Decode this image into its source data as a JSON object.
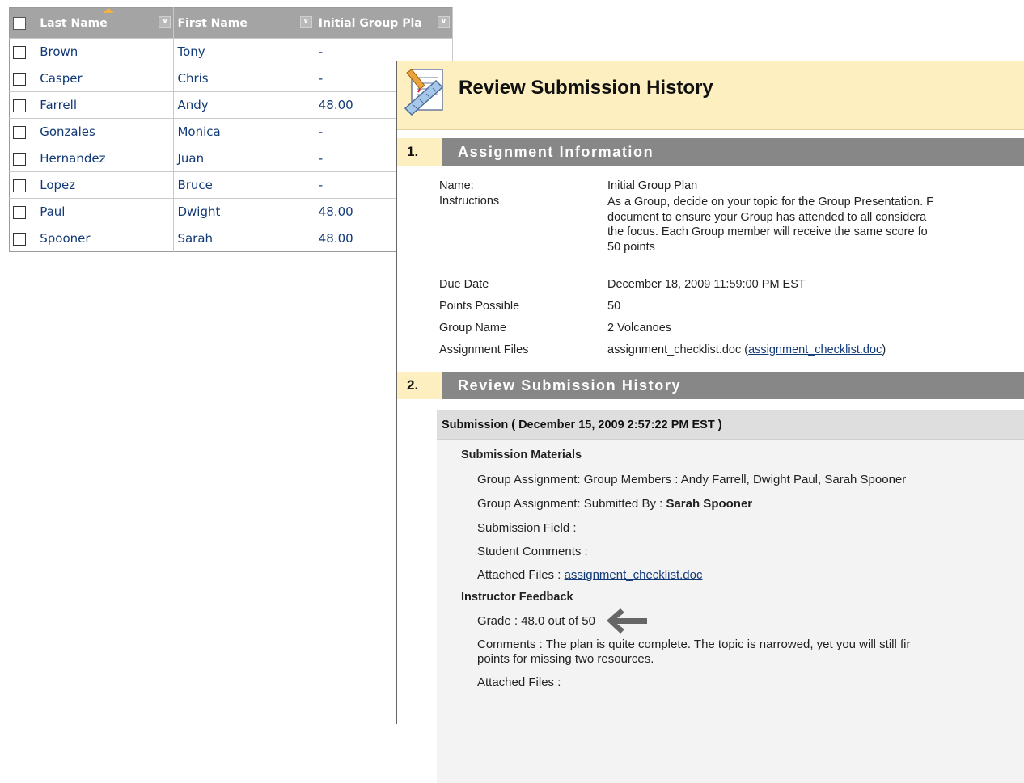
{
  "grid": {
    "columns": [
      "Last Name",
      "First Name",
      "Initial Group Pla"
    ],
    "rows": [
      {
        "last": "Brown",
        "first": "Tony",
        "grade": "-"
      },
      {
        "last": "Casper",
        "first": "Chris",
        "grade": "-"
      },
      {
        "last": "Farrell",
        "first": "Andy",
        "grade": "48.00"
      },
      {
        "last": "Gonzales",
        "first": "Monica",
        "grade": "-"
      },
      {
        "last": "Hernandez",
        "first": "Juan",
        "grade": "-"
      },
      {
        "last": "Lopez",
        "first": "Bruce",
        "grade": "-"
      },
      {
        "last": "Paul",
        "first": "Dwight",
        "grade": "48.00"
      },
      {
        "last": "Spooner",
        "first": "Sarah",
        "grade": "48.00"
      }
    ]
  },
  "panel": {
    "title": "Review Submission History",
    "step1": {
      "num": "1.",
      "title": "Assignment Information",
      "name_label": "Name:",
      "name_value": "Initial Group Plan",
      "instructions_label": "Instructions",
      "instructions_lines": [
        "As a Group, decide on your topic for the Group Presentation. F",
        "document to ensure your Group has attended to all considera",
        "the focus. Each Group member will receive the same score fo",
        "50 points"
      ],
      "due_label": "Due Date",
      "due_value": "December 18, 2009 11:59:00 PM EST",
      "points_label": "Points Possible",
      "points_value": "50",
      "group_label": "Group Name",
      "group_value": "2 Volcanoes",
      "files_label": "Assignment Files",
      "files_value": "assignment_checklist.doc (",
      "files_link": "assignment_checklist.doc",
      "files_close": ")"
    },
    "step2": {
      "num": "2.",
      "title": "Review Submission History",
      "submission_header": "Submission ( December 15, 2009 2:57:22 PM EST )",
      "materials_heading": "Submission Materials",
      "members": "Group Assignment: Group Members : Andy Farrell, Dwight Paul, Sarah Spooner",
      "submitted_by_label": "Group Assignment: Submitted By : ",
      "submitted_by": "Sarah Spooner",
      "submission_field": "Submission Field :",
      "student_comments": "Student Comments :",
      "attached_files_label": "Attached Files : ",
      "attached_files_link": "assignment_checklist.doc ",
      "feedback_heading": "Instructor Feedback",
      "grade": "Grade : 48.0 out of 50",
      "comments_line1": "Comments : The plan is quite complete. The topic is narrowed, yet you will still fir",
      "comments_line2": "points for missing two resources.",
      "feedback_files": "Attached Files :"
    }
  }
}
